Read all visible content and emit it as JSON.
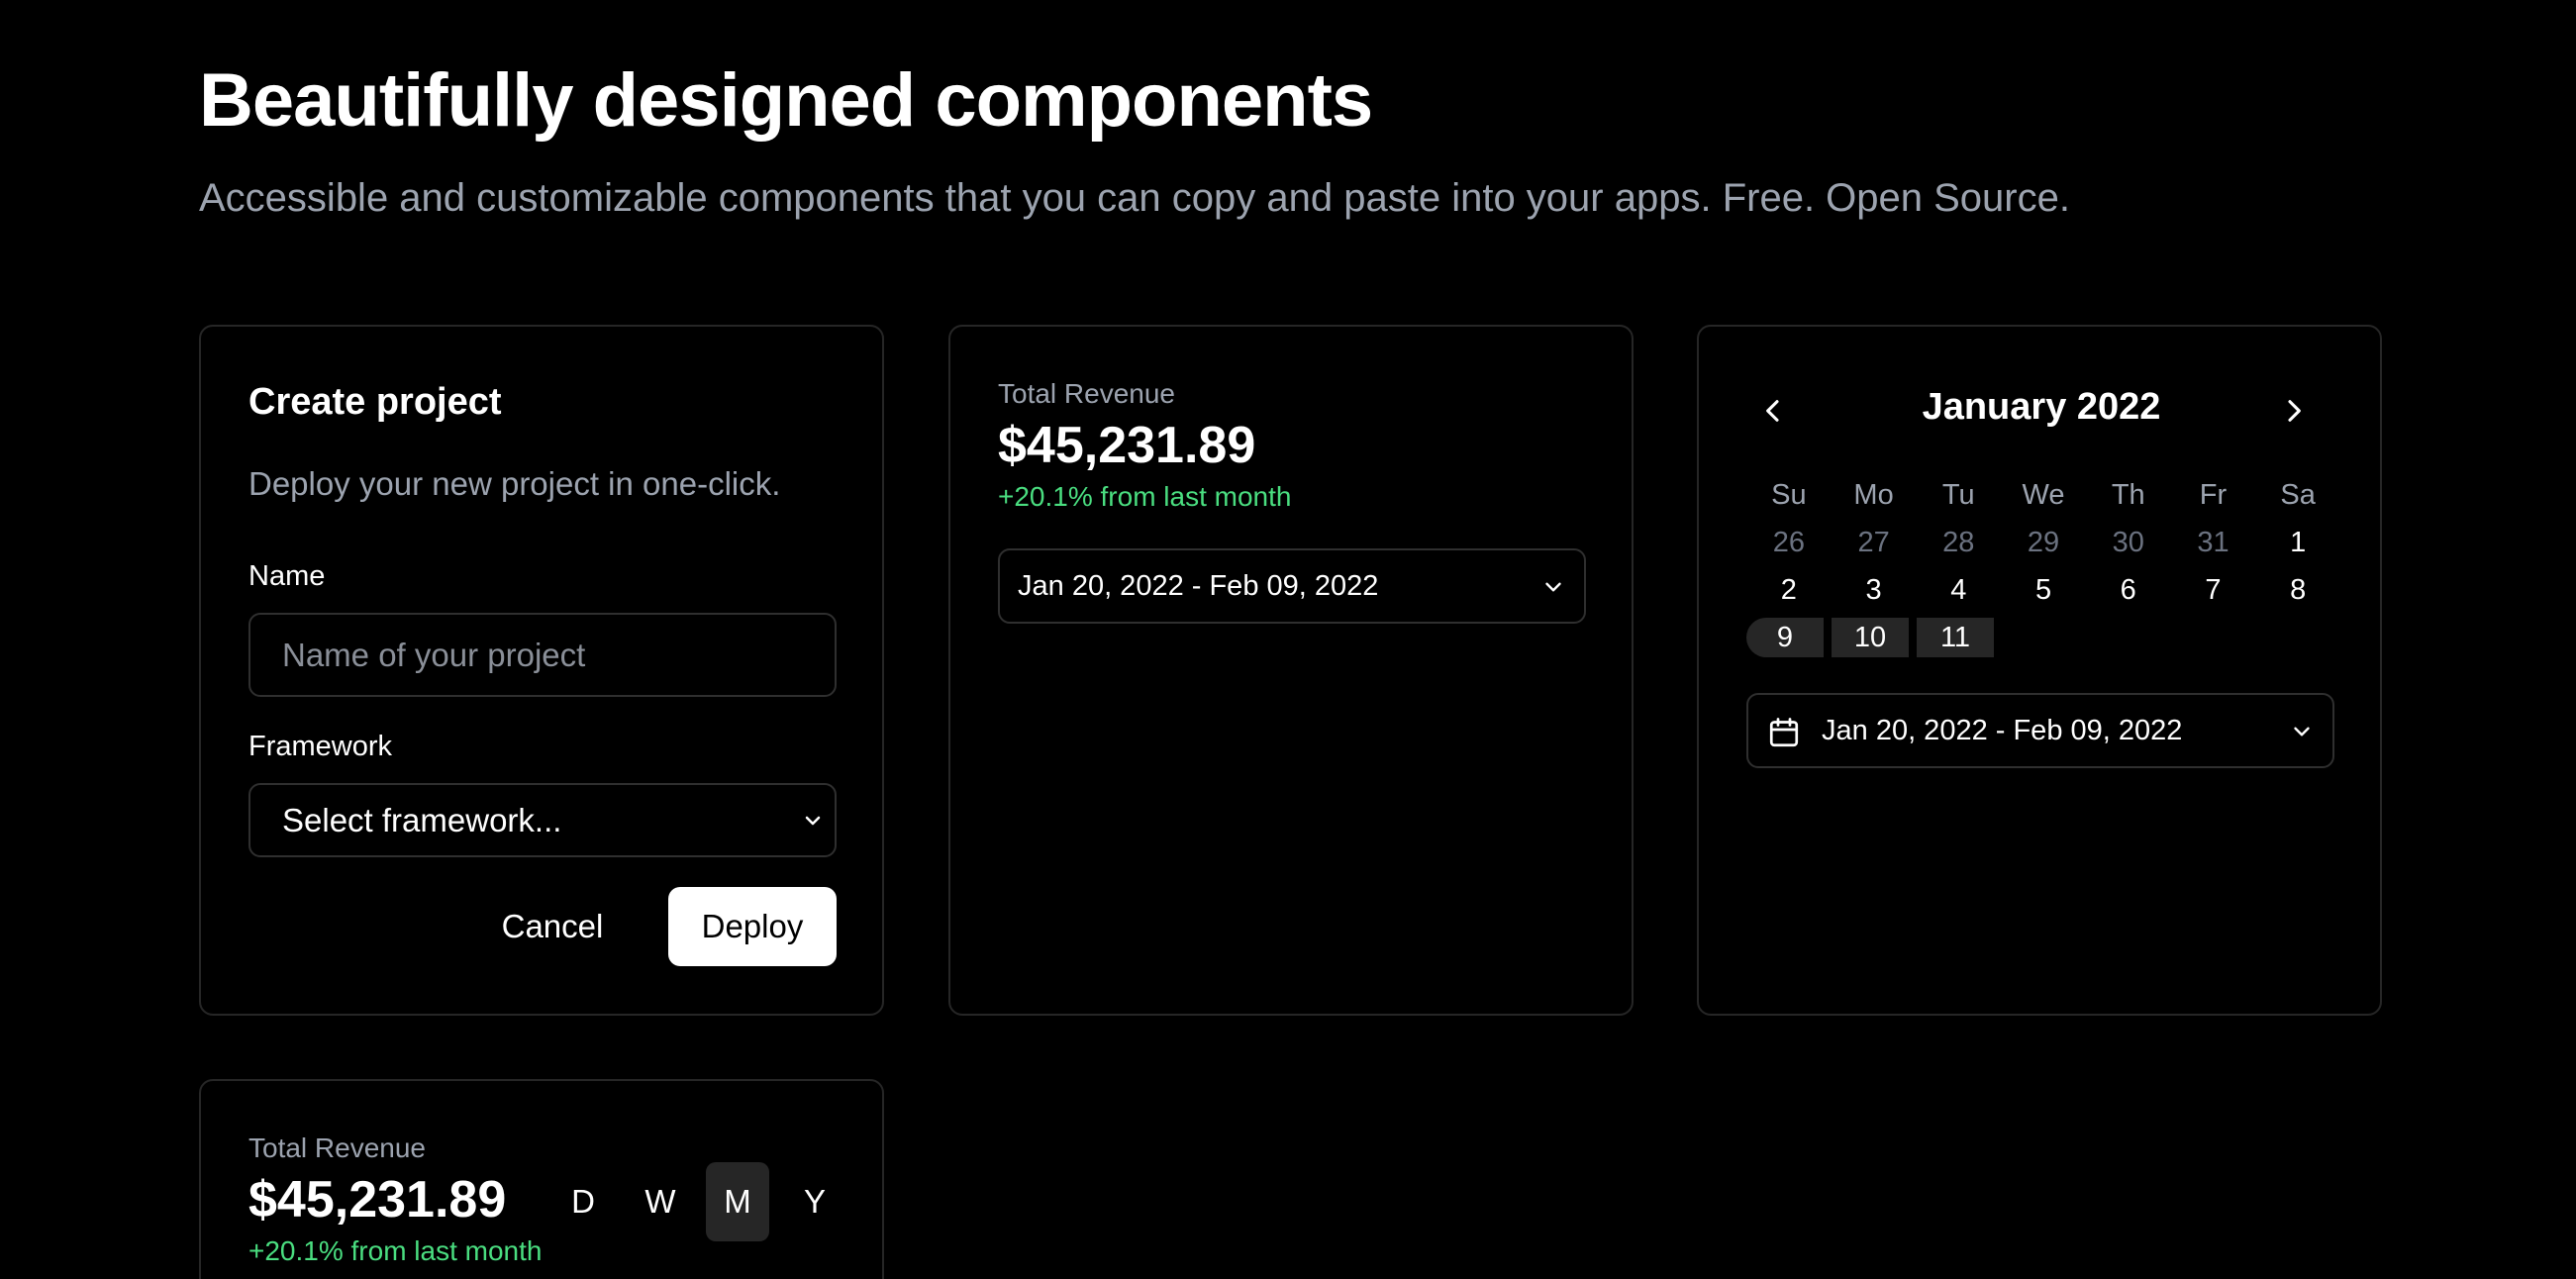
{
  "hero": {
    "title": "Beautifully designed components",
    "subtitle": "Accessible and customizable components that you can copy and paste into your apps. Free. Open Source."
  },
  "create_project": {
    "title": "Create project",
    "description": "Deploy your new project in one-click.",
    "name_label": "Name",
    "name_placeholder": "Name of your project",
    "name_value": "",
    "framework_label": "Framework",
    "framework_selected": "Select framework...",
    "cancel_label": "Cancel",
    "deploy_label": "Deploy"
  },
  "revenue_card": {
    "label": "Total Revenue",
    "value": "$45,231.89",
    "change": "+20.1% from last month",
    "date_range": "Jan 20, 2022 - Feb 09, 2022"
  },
  "calendar": {
    "month": "January 2022",
    "weekdays": [
      "Su",
      "Mo",
      "Tu",
      "We",
      "Th",
      "Fr",
      "Sa"
    ],
    "week1": [
      "26",
      "27",
      "28",
      "29",
      "30",
      "31",
      "1"
    ],
    "week2": [
      "2",
      "3",
      "4",
      "5",
      "6",
      "7",
      "8"
    ],
    "week3": [
      "9",
      "10",
      "11"
    ],
    "date_range": "Jan 20, 2022 - Feb 09, 2022"
  },
  "revenue_card_2": {
    "label": "Total Revenue",
    "value": "$45,231.89",
    "change": "+20.1% from last month",
    "periods": [
      "D",
      "W",
      "M",
      "Y"
    ],
    "active_period": "M"
  },
  "colors": {
    "background": "#000000",
    "border": "#262626",
    "muted_text": "#9ca3af",
    "positive": "#4ade80"
  },
  "icons": {
    "chevron_down": "chevron-down-icon",
    "chevron_left": "chevron-left-icon",
    "chevron_right": "chevron-right-icon",
    "calendar": "calendar-icon"
  }
}
